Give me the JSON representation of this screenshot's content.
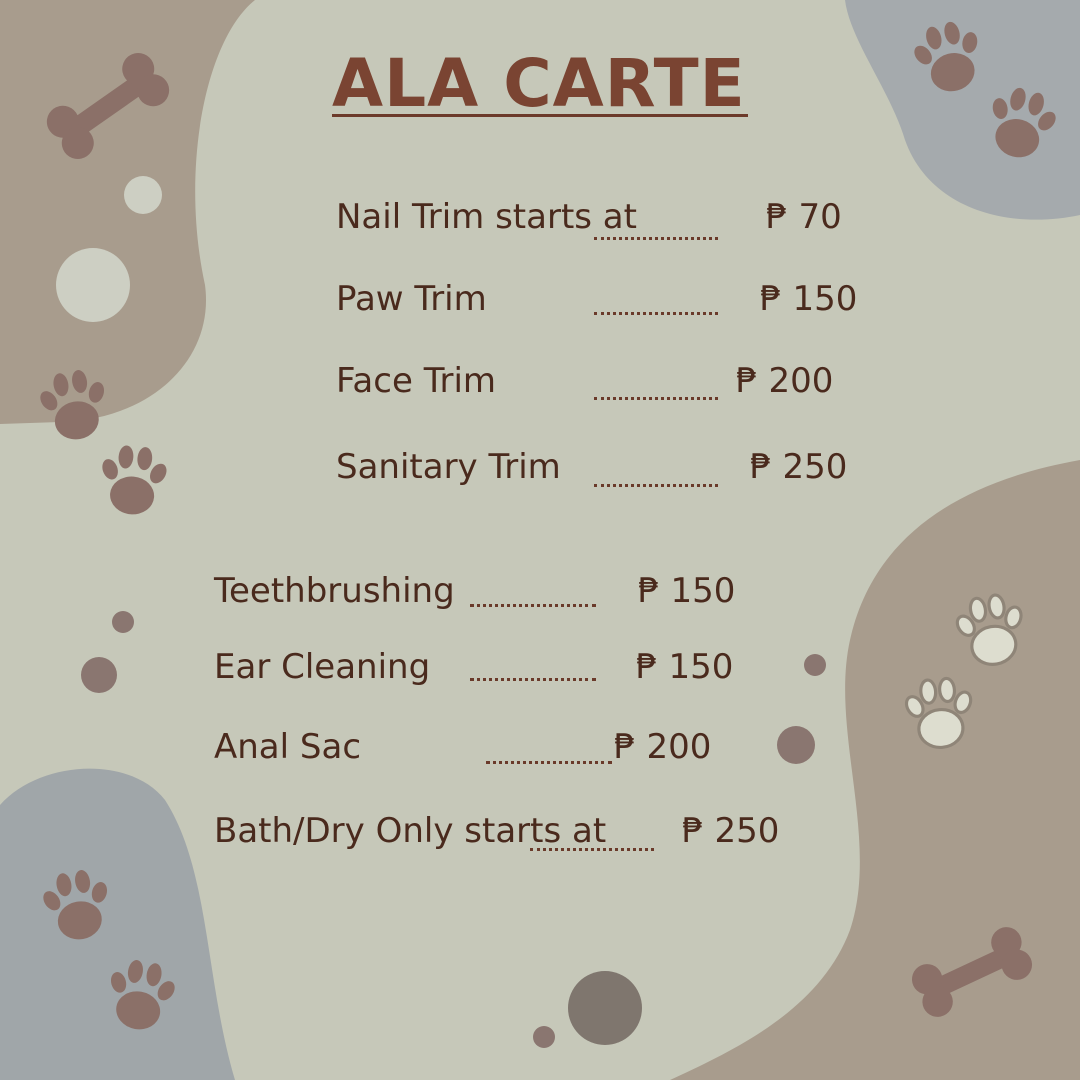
{
  "menu": {
    "title": "ALA CARTE",
    "groups": [
      {
        "items": [
          {
            "label": "Nail Trim starts at",
            "price": "₱ 70"
          },
          {
            "label": "Paw Trim",
            "price": "₱ 150"
          },
          {
            "label": "Face Trim",
            "price": "₱ 200"
          },
          {
            "label": "Sanitary Trim",
            "price": "₱ 250"
          }
        ]
      },
      {
        "items": [
          {
            "label": "Teethbrushing",
            "price": "₱ 150"
          },
          {
            "label": "Ear Cleaning",
            "price": "₱ 150"
          },
          {
            "label": "Anal Sac",
            "price": "₱ 200"
          },
          {
            "label": "Bath/Dry Only starts at",
            "price": "₱ 250"
          }
        ]
      }
    ]
  },
  "colors": {
    "background": "#c6c8b9",
    "blob_taupe": "#a89c8d",
    "blob_bluegray": "#a0a6a9",
    "text": "#4a2a1d",
    "title": "#7a4432",
    "paw": "#8b7068",
    "bone": "#8b7068"
  },
  "decorations": [
    "bone-icon",
    "paw-print-icon",
    "dot"
  ]
}
